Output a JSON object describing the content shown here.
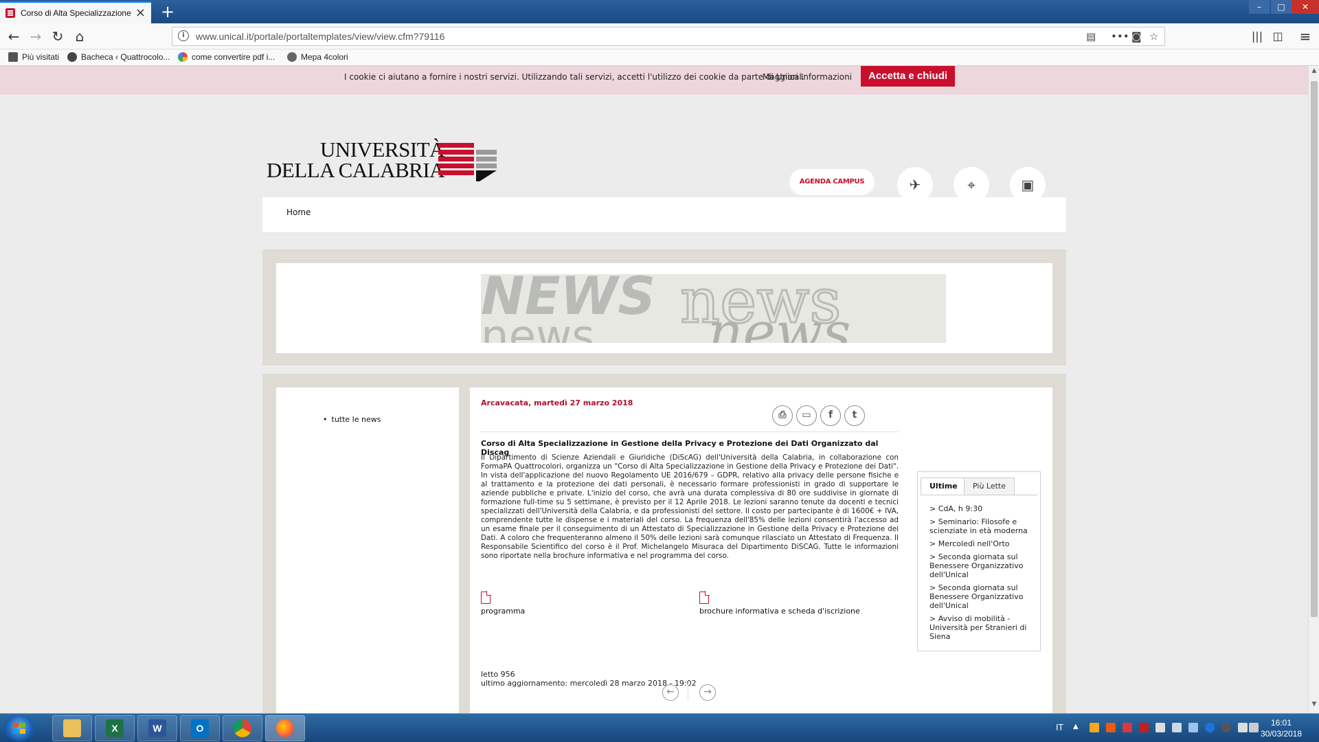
{
  "browser": {
    "tab_title": "Corso di Alta Specializzazione in",
    "url": "www.unical.it/portale/portaltemplates/view/view.cfm?79116",
    "bookmarks": [
      "Più visitati",
      "Bacheca ‹ Quattrocolo...",
      "come convertire pdf i...",
      "Mepa 4colori"
    ]
  },
  "cookie_banner": {
    "text": "I cookie ci aiutano a fornire i nostri servizi. Utilizzando tali servizi, accetti l'utilizzo dei cookie da parte di Unical.",
    "more_link": "Maggiori Informazioni",
    "accept_button": "Accetta e chiudi"
  },
  "header": {
    "logo_line1": "UNIVERSITÀ",
    "logo_line2": "DELLA CALABRIA",
    "agenda_label": "AGENDA CAMPUS",
    "nav_home": "Home"
  },
  "banner": {
    "word_bold": "NEWS",
    "word_outline": "news",
    "word_second": "news",
    "word_italic": "news"
  },
  "left_menu": {
    "items": [
      "tutte le news"
    ]
  },
  "article": {
    "date": "Arcavacata, martedì 27 marzo 2018",
    "title": "Corso di Alta Specializzazione in Gestione della Privacy e Protezione dei Dati Organizzato dal Discag",
    "body": "Il Dipartimento di Scienze Aziendali e Giuridiche (DiScAG) dell'Università della Calabria, in collaborazione con FormaPA Quattrocolori, organizza un \"Corso di Alta Specializzazione in Gestione della Privacy e Protezione dei Dati\". In vista dell'applicazione del nuovo Regolamento UE 2016/679 – GDPR, relativo alla privacy delle persone fisiche e al trattamento e la protezione dei dati personali, è necessario formare professionisti in grado di supportare le aziende pubbliche e private. L'inizio del corso, che avrà una durata complessiva di 80 ore suddivise in giornate di formazione full-time su 5 settimane, è previsto per il 12 Aprile 2018. Le lezioni saranno tenute da docenti e tecnici specializzati dell'Università della Calabria, e da professionisti del settore. Il costo per partecipante è di 1600€ + IVA, comprendente tutte le dispense e i materiali del corso. La frequenza dell'85% delle lezioni consentirà l'accesso ad un esame finale per il conseguimento di un Attestato di Specializzazione in Gestione della Privacy e Protezione dei Dati. A coloro che frequenteranno almeno il 50% delle lezioni sarà comunque rilasciato un Attestato di Frequenza. Il Responsabile Scientifico del corso è il Prof. Michelangelo Misuraca del Dipartimento DiSCAG. Tutte le informazioni sono riportate nella brochure informativa e nel programma del corso.",
    "attachments": [
      "programma",
      "brochure informativa e scheda d'iscrizione"
    ],
    "read_count": "letto 956",
    "last_update": "ultimo aggiornamento: mercoledì 28 marzo 2018 - 19:02",
    "back_link": "indietro"
  },
  "sidebar": {
    "tabs": [
      "Ultime",
      "Più Lette"
    ],
    "active_tab": "Ultime",
    "items": [
      "> CdA, h 9:30",
      "> Seminario: Filosofe e scienziate in età moderna",
      "> Mercoledì nell'Orto",
      "> Seconda giornata sul Benessere Organizzativo dell'Unical",
      "> Seconda giornata sul Benessere Organizzativo dell'Unical",
      "> Avviso di mobilità - Università per Stranieri di Siena"
    ]
  },
  "taskbar": {
    "language": "IT",
    "time": "16:01",
    "date": "30/03/2018"
  },
  "colors": {
    "brand_red": "#c8102e",
    "taskbar_blue": "#1f4f8a",
    "page_bg": "#ececec",
    "frame_beige": "#dedcd5"
  }
}
